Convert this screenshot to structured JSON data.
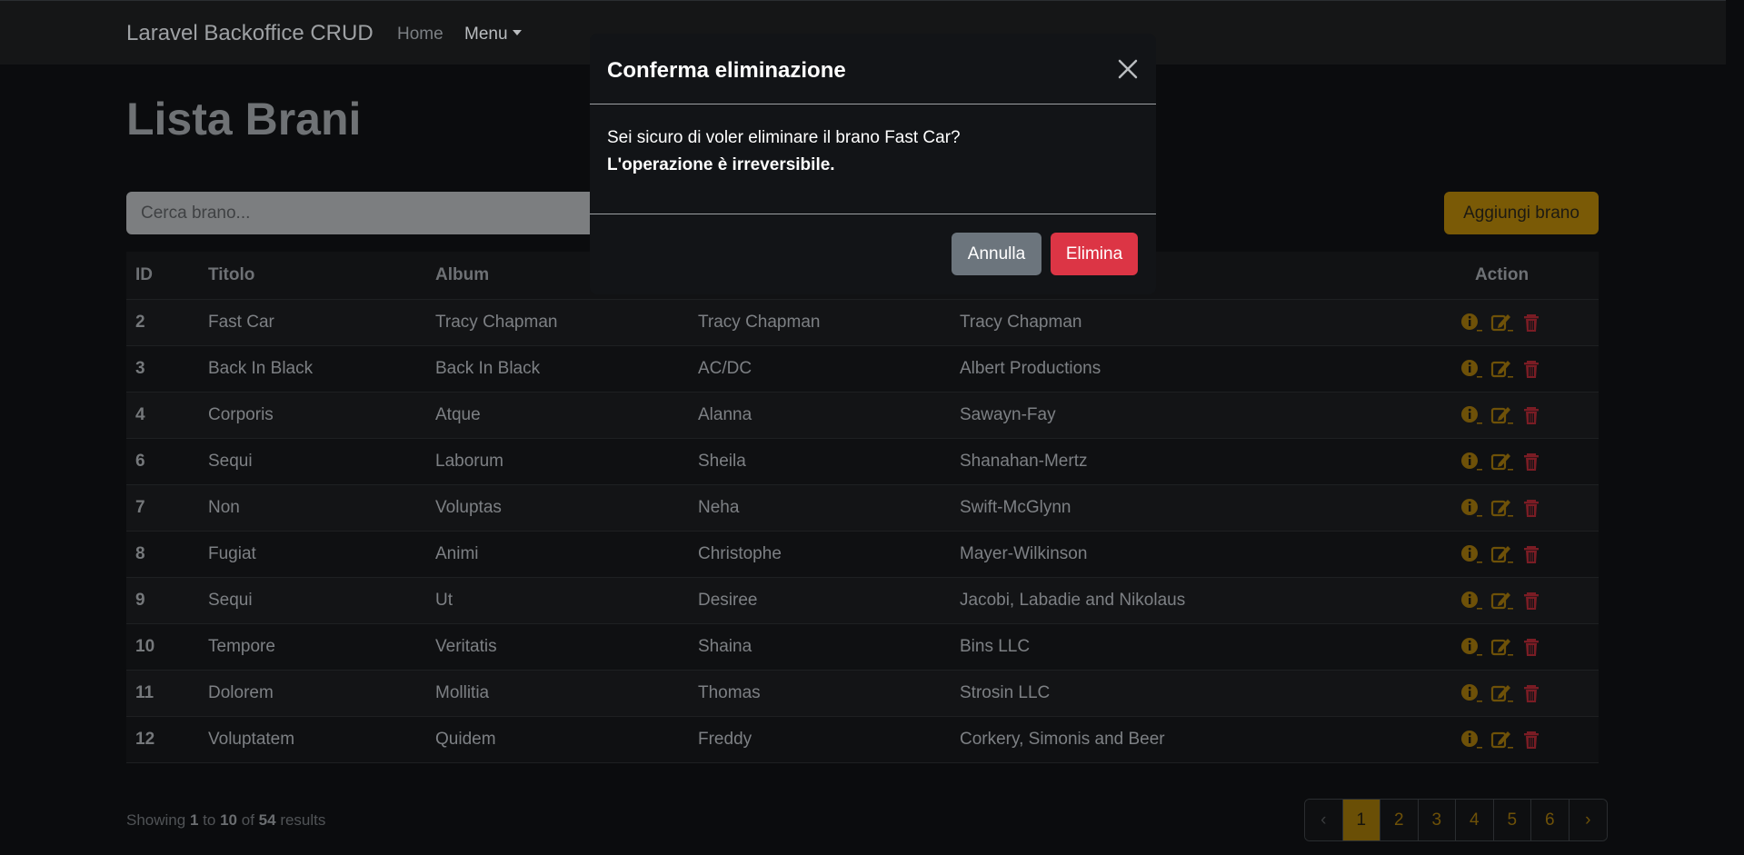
{
  "navbar": {
    "brand": "Laravel Backoffice CRUD",
    "home": "Home",
    "menu": "Menu"
  },
  "page": {
    "title": "Lista Brani",
    "search_placeholder": "Cerca brano...",
    "add_button": "Aggiungi brano"
  },
  "table": {
    "headers": {
      "id": "ID",
      "titolo": "Titolo",
      "album": "Album",
      "action": "Action"
    },
    "rows": [
      {
        "id": "2",
        "titolo": "Fast Car",
        "album": "Tracy Chapman",
        "artista": "Tracy Chapman",
        "etichetta": "Tracy Chapman"
      },
      {
        "id": "3",
        "titolo": "Back In Black",
        "album": "Back In Black",
        "artista": "AC/DC",
        "etichetta": "Albert Productions"
      },
      {
        "id": "4",
        "titolo": "Corporis",
        "album": "Atque",
        "artista": "Alanna",
        "etichetta": "Sawayn-Fay"
      },
      {
        "id": "6",
        "titolo": "Sequi",
        "album": "Laborum",
        "artista": "Sheila",
        "etichetta": "Shanahan-Mertz"
      },
      {
        "id": "7",
        "titolo": "Non",
        "album": "Voluptas",
        "artista": "Neha",
        "etichetta": "Swift-McGlynn"
      },
      {
        "id": "8",
        "titolo": "Fugiat",
        "album": "Animi",
        "artista": "Christophe",
        "etichetta": "Mayer-Wilkinson"
      },
      {
        "id": "9",
        "titolo": "Sequi",
        "album": "Ut",
        "artista": "Desiree",
        "etichetta": "Jacobi, Labadie and Nikolaus"
      },
      {
        "id": "10",
        "titolo": "Tempore",
        "album": "Veritatis",
        "artista": "Shaina",
        "etichetta": "Bins LLC"
      },
      {
        "id": "11",
        "titolo": "Dolorem",
        "album": "Mollitia",
        "artista": "Thomas",
        "etichetta": "Strosin LLC"
      },
      {
        "id": "12",
        "titolo": "Voluptatem",
        "album": "Quidem",
        "artista": "Freddy",
        "etichetta": "Corkery, Simonis and Beer"
      }
    ],
    "action_icons": [
      "info-circle-icon",
      "edit-icon",
      "trash-icon"
    ]
  },
  "footer": {
    "showing_prefix": "Showing",
    "from": "1",
    "to_word": "to",
    "to": "10",
    "of_word": "of",
    "total": "54",
    "results_word": "results"
  },
  "pagination": {
    "prev": "‹",
    "pages": [
      "1",
      "2",
      "3",
      "4",
      "5",
      "6"
    ],
    "current": "1",
    "next": "›"
  },
  "modal": {
    "title": "Conferma eliminazione",
    "message": "Sei sicuro di voler eliminare il brano Fast Car?",
    "warning": "L'operazione è irreversibile.",
    "cancel_label": "Annulla",
    "confirm_label": "Elimina"
  },
  "colors": {
    "warning": "#b8860b",
    "danger": "#dc3545",
    "secondary": "#6c757d"
  }
}
